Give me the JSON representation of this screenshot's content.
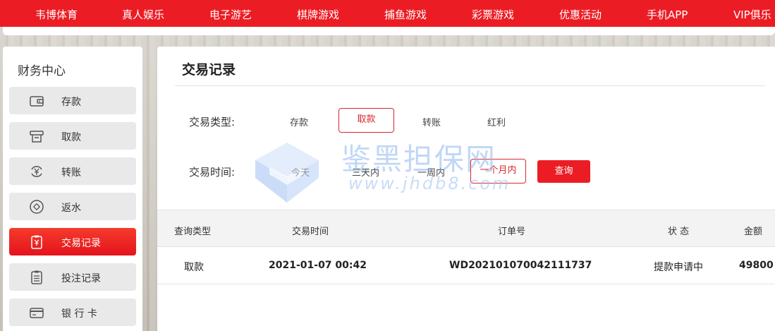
{
  "nav": {
    "items": [
      "韦博体育",
      "真人娱乐",
      "电子游艺",
      "棋牌游戏",
      "捕鱼游戏",
      "彩票游戏",
      "优惠活动",
      "手机APP",
      "VIP俱乐"
    ]
  },
  "sidebar": {
    "title": "财务中心",
    "items": [
      {
        "label": "存款",
        "icon": "wallet-icon"
      },
      {
        "label": "取款",
        "icon": "withdraw-icon"
      },
      {
        "label": "转账",
        "icon": "transfer-icon"
      },
      {
        "label": "返水",
        "icon": "rebate-icon"
      },
      {
        "label": "交易记录",
        "icon": "record-icon",
        "active": true
      },
      {
        "label": "投注记录",
        "icon": "clipboard-icon"
      },
      {
        "label": "银 行 卡",
        "icon": "bank-card-icon"
      }
    ]
  },
  "main": {
    "title": "交易记录",
    "filter_type": {
      "label": "交易类型:",
      "options": [
        "存款",
        "取款",
        "转账",
        "红利"
      ],
      "selected": "取款"
    },
    "filter_time": {
      "label": "交易时间:",
      "options": [
        "今天",
        "三天内",
        "一周内",
        "一个月内"
      ],
      "selected": "一个月内"
    },
    "query_button": "查询",
    "table": {
      "headers": [
        "查询类型",
        "交易时间",
        "订单号",
        "状 态",
        "金额"
      ],
      "rows": [
        [
          "取款",
          "2021-01-07 00:42",
          "WD202101070042111737",
          "提款申请中",
          "49800"
        ]
      ]
    }
  },
  "watermark": {
    "text": "鉴黑担保网",
    "url": "www.jhdb8.com"
  },
  "colors": {
    "brand_red": "#ec1c24",
    "accent_red": "#d9272e",
    "watermark_blue": "#8fb8f0"
  }
}
